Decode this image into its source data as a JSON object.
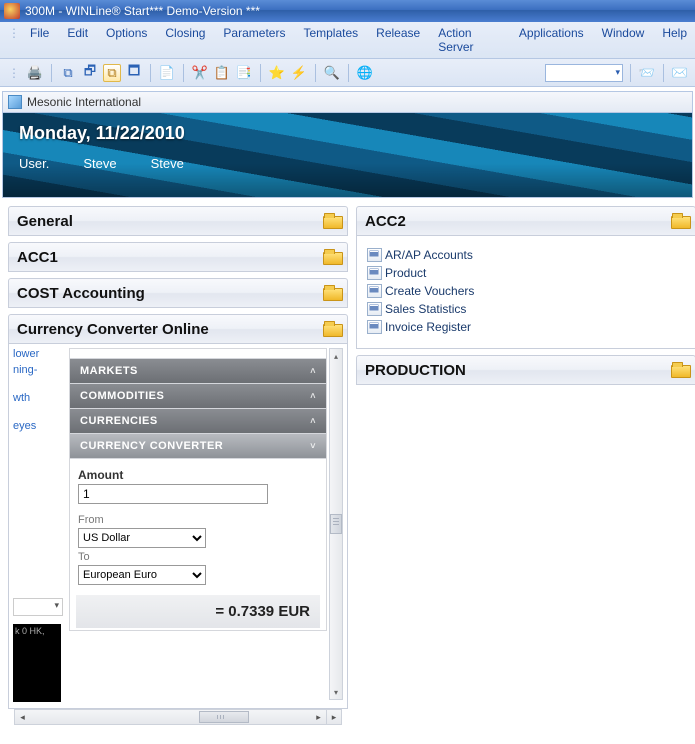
{
  "title": "300M - WINLine® Start*** Demo-Version ***",
  "menu": [
    "File",
    "Edit",
    "Options",
    "Closing",
    "Parameters",
    "Templates",
    "Release",
    "Action Server",
    "Applications",
    "Window",
    "Help"
  ],
  "subwindow_title": "Mesonic International",
  "banner": {
    "day_date": "Monday, 11/22/2010",
    "cols": [
      "User.",
      "Steve",
      "Steve"
    ]
  },
  "panels_left": {
    "general": "General",
    "acc1": "ACC1",
    "cost": "COST Accounting",
    "currency_head": "Currency Converter Online"
  },
  "panels_right": {
    "acc2": "ACC2",
    "acc2_items": [
      "AR/AP Accounts",
      "Product",
      "Create Vouchers",
      "Sales Statistics",
      "Invoice Register"
    ],
    "production": "PRODUCTION"
  },
  "currency": {
    "side_links": [
      "lower",
      "ning-",
      "wth",
      "eyes"
    ],
    "block_text": "k\n0 HK,",
    "tabs": {
      "markets": "MARKETS",
      "commodities": "COMMODITIES",
      "currencies": "CURRENCIES",
      "converter": "CURRENCY CONVERTER"
    },
    "amount_label": "Amount",
    "amount_value": "1",
    "from_label": "From",
    "from_value": "US Dollar",
    "to_label": "To",
    "to_value": "European Euro",
    "result": "= 0.7339 EUR"
  }
}
